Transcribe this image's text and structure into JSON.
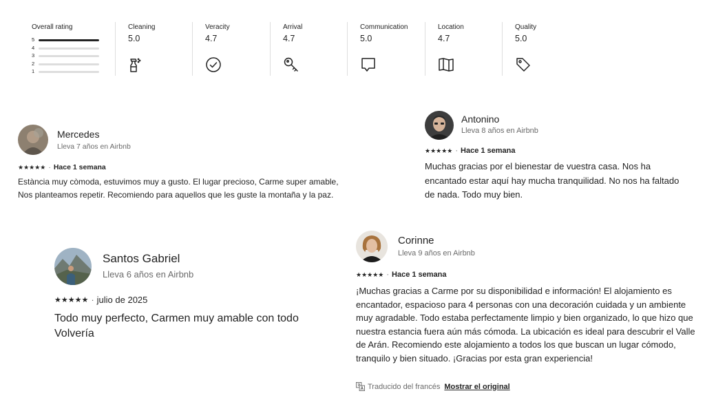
{
  "ratings": {
    "overall": {
      "label": "Overall rating",
      "distribution": [
        {
          "stars": "5",
          "fraction": 1.0
        },
        {
          "stars": "4",
          "fraction": 0.0
        },
        {
          "stars": "3",
          "fraction": 0.0
        },
        {
          "stars": "2",
          "fraction": 0.0
        },
        {
          "stars": "1",
          "fraction": 0.0
        }
      ]
    },
    "categories": [
      {
        "label": "Cleaning",
        "value": "5.0",
        "icon": "spray-bottle-icon"
      },
      {
        "label": "Veracity",
        "value": "4.7",
        "icon": "check-circle-icon"
      },
      {
        "label": "Arrival",
        "value": "4.7",
        "icon": "key-icon"
      },
      {
        "label": "Communication",
        "value": "5.0",
        "icon": "chat-bubble-icon"
      },
      {
        "label": "Location",
        "value": "4.7",
        "icon": "map-icon"
      },
      {
        "label": "Quality",
        "value": "5.0",
        "icon": "price-tag-icon"
      }
    ]
  },
  "reviews": {
    "mercedes": {
      "name": "Mercedes",
      "since": "Lleva 7 años en Airbnb",
      "stars": "★★★★★",
      "separator": "·",
      "when": "Hace 1 semana",
      "text": "Estància muy còmoda, estuvimos muy a gusto. El lugar precioso, Carme super amable, Nos planteamos repetir. Recomiendo para aquellos que les guste la montaña y la paz."
    },
    "antonino": {
      "name": "Antonino",
      "since": "Lleva 8 años en Airbnb",
      "stars": "★★★★★",
      "separator": "·",
      "when": "Hace 1 semana",
      "text": "Muchas gracias por el bienestar de vuestra casa. Nos ha encantado estar aquí hay mucha tranquilidad. No nos ha faltado de nada. Todo muy bien."
    },
    "santos": {
      "name": "Santos Gabriel",
      "since": "Lleva 6 años en Airbnb",
      "stars": "★★★★★",
      "separator": "·",
      "when": "julio de 2025",
      "text": "Todo muy perfecto, Carmen muy amable con todo Volvería"
    },
    "corinne": {
      "name": "Corinne",
      "since": "Lleva 9 años en Airbnb",
      "stars": "★★★★★",
      "separator": "·",
      "when": "Hace 1 semana",
      "text": "¡Muchas gracias a Carme por su disponibilidad e información! El alojamiento es encantador,  espacioso para 4 personas con una decoración cuidada y un ambiente muy agradable. Todo estaba perfectamente limpio y bien organizado, lo que hizo que nuestra estancia fuera aún más cómoda. La ubicación es ideal para descubrir el Valle de Arán. Recomiendo este alojamiento a todos los que buscan un lugar cómodo, tranquilo y bien situado. ¡Gracias por esta gran experiencia!",
      "translated_note": "Traducido del francés",
      "show_original": "Mostrar el original"
    }
  }
}
